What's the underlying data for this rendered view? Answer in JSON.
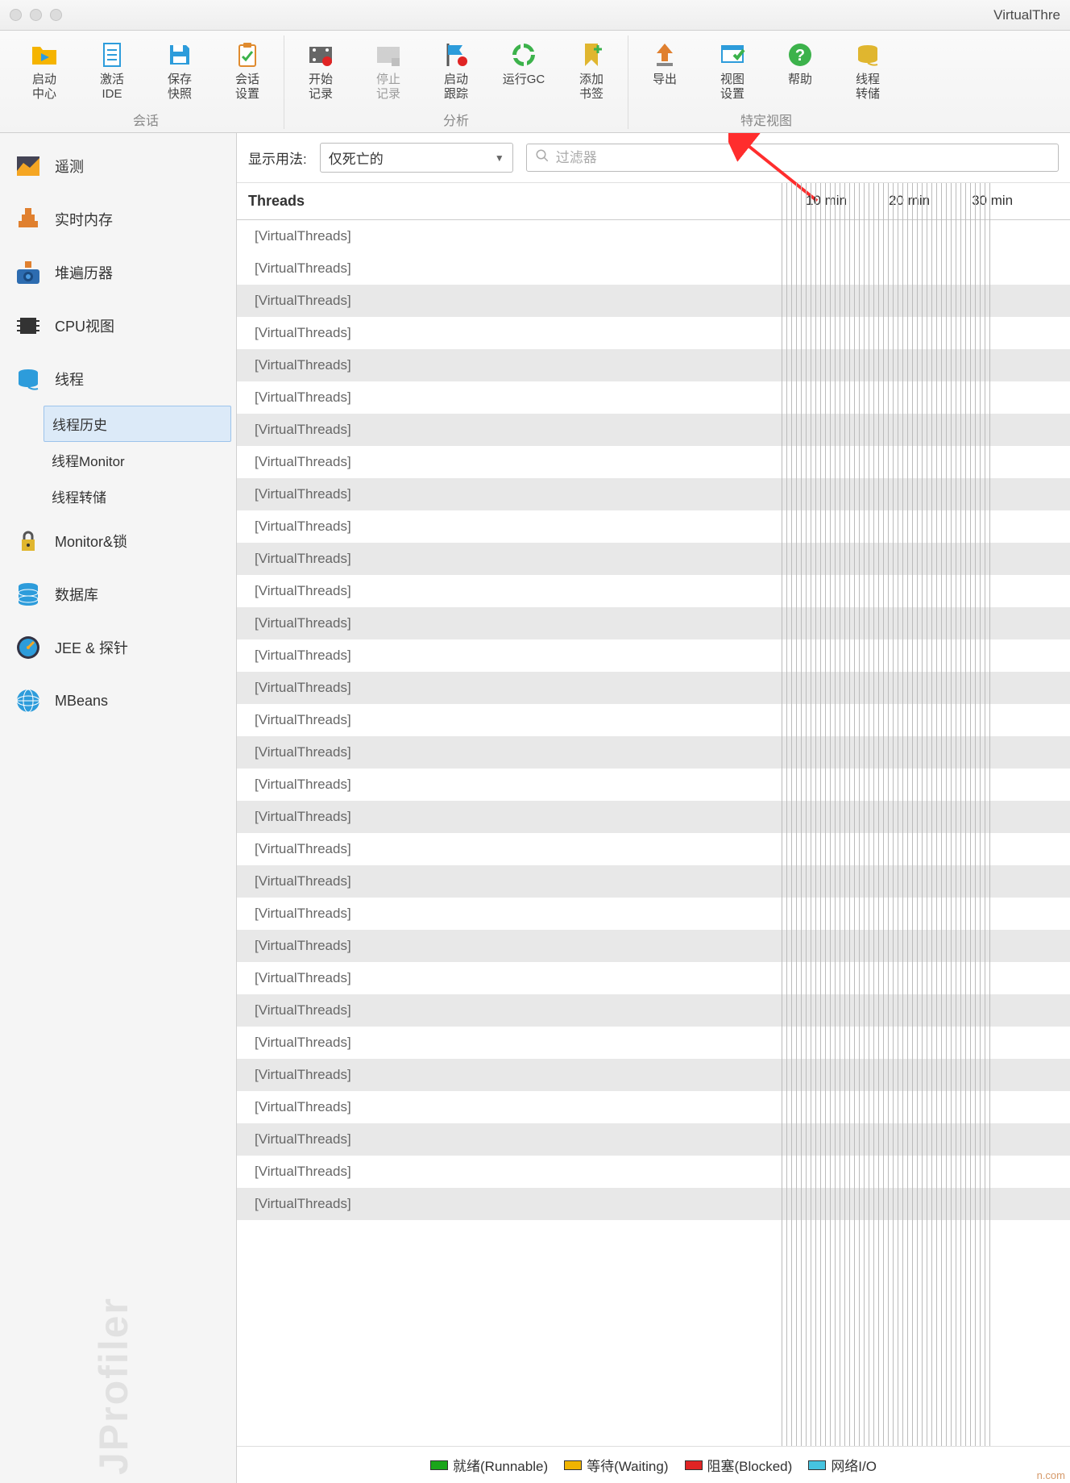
{
  "window": {
    "title": "VirtualThre"
  },
  "toolbar": {
    "groups": [
      {
        "label": "会话",
        "buttons": [
          {
            "id": "start-center",
            "label": "启动\n中心",
            "icon": "folder-play",
            "color": "#f5b400"
          },
          {
            "id": "activate-ide",
            "label": "激活\nIDE",
            "icon": "doc-lines",
            "color": "#2d9cdb"
          },
          {
            "id": "save-snapshot",
            "label": "保存\n快照",
            "icon": "save",
            "color": "#2d9cdb"
          },
          {
            "id": "session-settings",
            "label": "会话\n设置",
            "icon": "clipboard-check",
            "color": "#e08b2f"
          }
        ]
      },
      {
        "label": "分析",
        "buttons": [
          {
            "id": "start-recording",
            "label": "开始\n记录",
            "icon": "film-record",
            "color": "#555"
          },
          {
            "id": "stop-recording",
            "label": "停止\n记录",
            "icon": "film-stop",
            "color": "#aaa",
            "disabled": true
          },
          {
            "id": "start-tracking",
            "label": "启动\n跟踪",
            "icon": "flag-record",
            "color": "#2d9cdb"
          },
          {
            "id": "run-gc",
            "label": "运行GC",
            "icon": "recycle",
            "color": "#3cb24b"
          },
          {
            "id": "add-bookmark",
            "label": "添加\n书签",
            "icon": "bookmark-plus",
            "color": "#e0b62f"
          }
        ]
      },
      {
        "label": "特定视图",
        "buttons": [
          {
            "id": "export",
            "label": "导出",
            "icon": "upload",
            "color": "#e0802f"
          },
          {
            "id": "view-settings",
            "label": "视图\n设置",
            "icon": "window-check",
            "color": "#2d9cdb"
          },
          {
            "id": "help",
            "label": "帮助",
            "icon": "help",
            "color": "#3cb24b"
          },
          {
            "id": "thread-dump",
            "label": "线程\n转储",
            "icon": "spool",
            "color": "#e0b62f"
          }
        ]
      }
    ]
  },
  "sidebar": {
    "items": [
      {
        "id": "telemetry",
        "label": "遥测",
        "icon": "chart"
      },
      {
        "id": "live-memory",
        "label": "实时内存",
        "icon": "blocks"
      },
      {
        "id": "heap-walker",
        "label": "堆遍历器",
        "icon": "camera"
      },
      {
        "id": "cpu-views",
        "label": "CPU视图",
        "icon": "chip"
      },
      {
        "id": "threads",
        "label": "线程",
        "icon": "spool",
        "expanded": true,
        "children": [
          {
            "id": "thread-history",
            "label": "线程历史",
            "selected": true
          },
          {
            "id": "thread-monitor",
            "label": "线程Monitor"
          },
          {
            "id": "thread-dump",
            "label": "线程转储"
          }
        ]
      },
      {
        "id": "monitors-locks",
        "label": "Monitor&锁",
        "icon": "lock"
      },
      {
        "id": "databases",
        "label": "数据库",
        "icon": "database"
      },
      {
        "id": "jee-probes",
        "label": "JEE & 探针",
        "icon": "gauge"
      },
      {
        "id": "mbeans",
        "label": "MBeans",
        "icon": "globe"
      }
    ],
    "watermark": "JProfiler"
  },
  "filter": {
    "label": "显示用法:",
    "dropdown_value": "仅死亡的",
    "search_placeholder": "过滤器"
  },
  "threads": {
    "header": "Threads",
    "timeline_labels": [
      "10 min",
      "20 min",
      "30 min"
    ],
    "rows": [
      "[VirtualThreads]",
      "[VirtualThreads]",
      "[VirtualThreads]",
      "[VirtualThreads]",
      "[VirtualThreads]",
      "[VirtualThreads]",
      "[VirtualThreads]",
      "[VirtualThreads]",
      "[VirtualThreads]",
      "[VirtualThreads]",
      "[VirtualThreads]",
      "[VirtualThreads]",
      "[VirtualThreads]",
      "[VirtualThreads]",
      "[VirtualThreads]",
      "[VirtualThreads]",
      "[VirtualThreads]",
      "[VirtualThreads]",
      "[VirtualThreads]",
      "[VirtualThreads]",
      "[VirtualThreads]",
      "[VirtualThreads]",
      "[VirtualThreads]",
      "[VirtualThreads]",
      "[VirtualThreads]",
      "[VirtualThreads]",
      "[VirtualThreads]",
      "[VirtualThreads]",
      "[VirtualThreads]",
      "[VirtualThreads]",
      "[VirtualThreads]"
    ]
  },
  "legend": {
    "items": [
      {
        "label": "就绪(Runnable)",
        "color": "#1aa51a"
      },
      {
        "label": "等待(Waiting)",
        "color": "#f0b400"
      },
      {
        "label": "阻塞(Blocked)",
        "color": "#e02424"
      },
      {
        "label": "网络I/O",
        "color": "#46c4e0"
      }
    ],
    "corner_mark": "n.com"
  }
}
